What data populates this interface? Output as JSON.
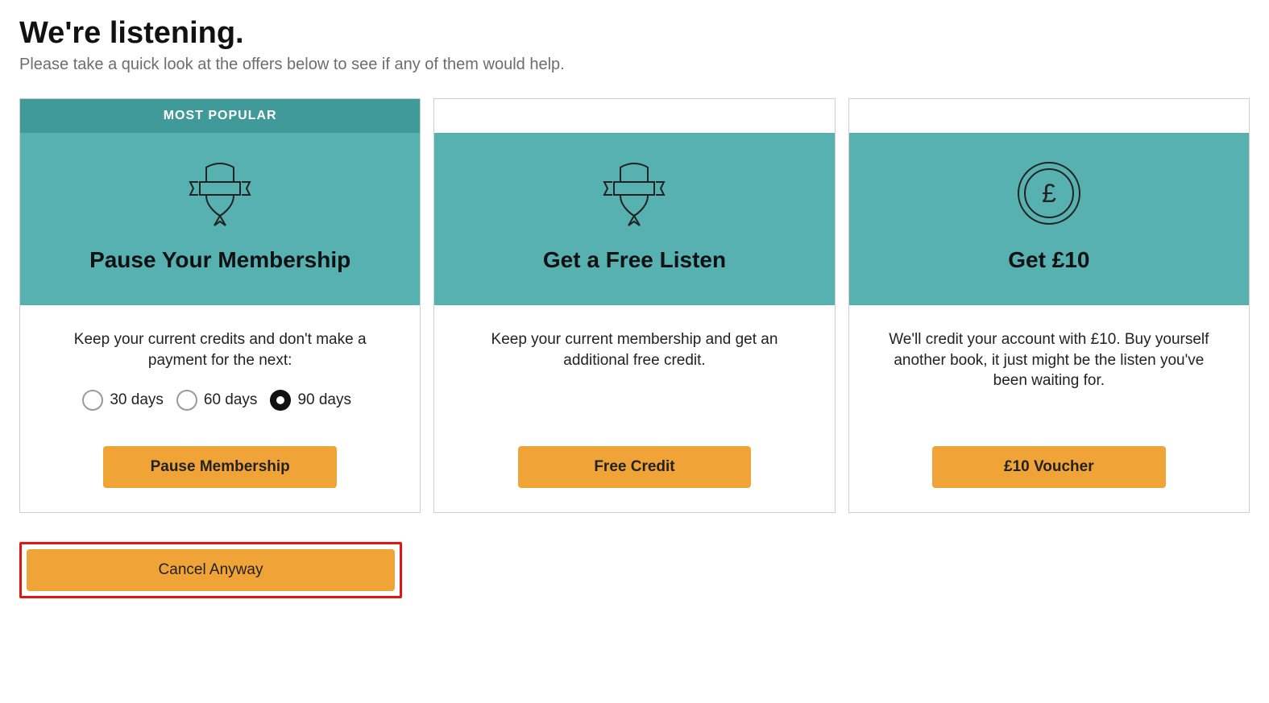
{
  "header": {
    "title": "We're listening.",
    "subtitle": "Please take a quick look at the offers below to see if any of them would help."
  },
  "cards": {
    "pause": {
      "badge": "MOST POPULAR",
      "title": "Pause Your Membership",
      "desc": "Keep your current credits and don't make a payment for the next:",
      "options": [
        {
          "label": "30 days",
          "selected": false
        },
        {
          "label": "60 days",
          "selected": false
        },
        {
          "label": "90 days",
          "selected": true
        }
      ],
      "button": "Pause Membership"
    },
    "free_listen": {
      "title": "Get a Free Listen",
      "desc": "Keep your current membership and get an additional free credit.",
      "button": "Free Credit"
    },
    "voucher": {
      "title": "Get £10",
      "desc": "We'll credit your account with £10. Buy yourself another book, it just might be the listen you've been waiting for.",
      "button": "£10 Voucher"
    }
  },
  "cancel": {
    "button": "Cancel Anyway"
  }
}
